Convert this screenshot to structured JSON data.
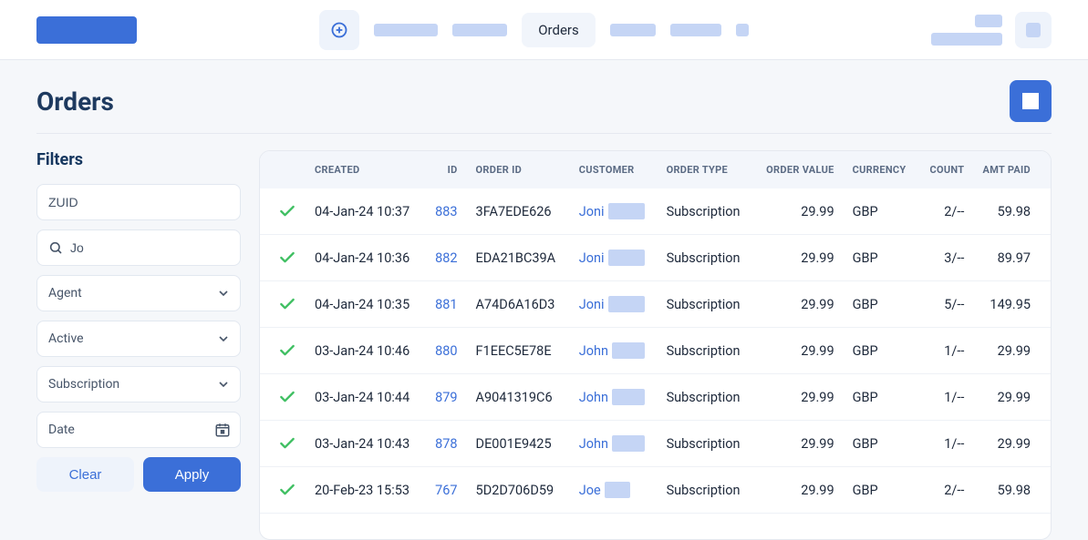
{
  "nav": {
    "active_tab": "Orders"
  },
  "page": {
    "title": "Orders"
  },
  "filters": {
    "heading": "Filters",
    "zuid_value": "ZUID",
    "search_value": "Jo",
    "agent_value": "Agent",
    "status_value": "Active",
    "type_value": "Subscription",
    "date_value": "Date",
    "clear_label": "Clear",
    "apply_label": "Apply"
  },
  "table": {
    "headers": {
      "created": "CREATED",
      "id": "ID",
      "order_id": "ORDER ID",
      "customer": "CUSTOMER",
      "order_type": "ORDER TYPE",
      "order_value": "ORDER VALUE",
      "currency": "CURRENCY",
      "count": "COUNT",
      "amt_paid": "AMT PAID"
    },
    "rows": [
      {
        "created": "04-Jan-24 10:37",
        "id": "883",
        "order_id": "3FA7EDE626",
        "customer": "Joni",
        "redact_w": 40,
        "order_type": "Subscription",
        "order_value": "29.99",
        "currency": "GBP",
        "count": "2/--",
        "amt_paid": "59.98"
      },
      {
        "created": "04-Jan-24 10:36",
        "id": "882",
        "order_id": "EDA21BC39A",
        "customer": "Joni",
        "redact_w": 40,
        "order_type": "Subscription",
        "order_value": "29.99",
        "currency": "GBP",
        "count": "3/--",
        "amt_paid": "89.97"
      },
      {
        "created": "04-Jan-24 10:35",
        "id": "881",
        "order_id": "A74D6A16D3",
        "customer": "Joni",
        "redact_w": 40,
        "order_type": "Subscription",
        "order_value": "29.99",
        "currency": "GBP",
        "count": "5/--",
        "amt_paid": "149.95"
      },
      {
        "created": "03-Jan-24 10:46",
        "id": "880",
        "order_id": "F1EEC5E78E",
        "customer": "John",
        "redact_w": 36,
        "order_type": "Subscription",
        "order_value": "29.99",
        "currency": "GBP",
        "count": "1/--",
        "amt_paid": "29.99"
      },
      {
        "created": "03-Jan-24 10:44",
        "id": "879",
        "order_id": "A9041319C6",
        "customer": "John",
        "redact_w": 36,
        "order_type": "Subscription",
        "order_value": "29.99",
        "currency": "GBP",
        "count": "1/--",
        "amt_paid": "29.99"
      },
      {
        "created": "03-Jan-24 10:43",
        "id": "878",
        "order_id": "DE001E9425",
        "customer": "John",
        "redact_w": 36,
        "order_type": "Subscription",
        "order_value": "29.99",
        "currency": "GBP",
        "count": "1/--",
        "amt_paid": "29.99"
      },
      {
        "created": "20-Feb-23 15:53",
        "id": "767",
        "order_id": "5D2D706D59",
        "customer": "Joe",
        "redact_w": 28,
        "order_type": "Subscription",
        "order_value": "29.99",
        "currency": "GBP",
        "count": "2/--",
        "amt_paid": "59.98"
      }
    ]
  }
}
